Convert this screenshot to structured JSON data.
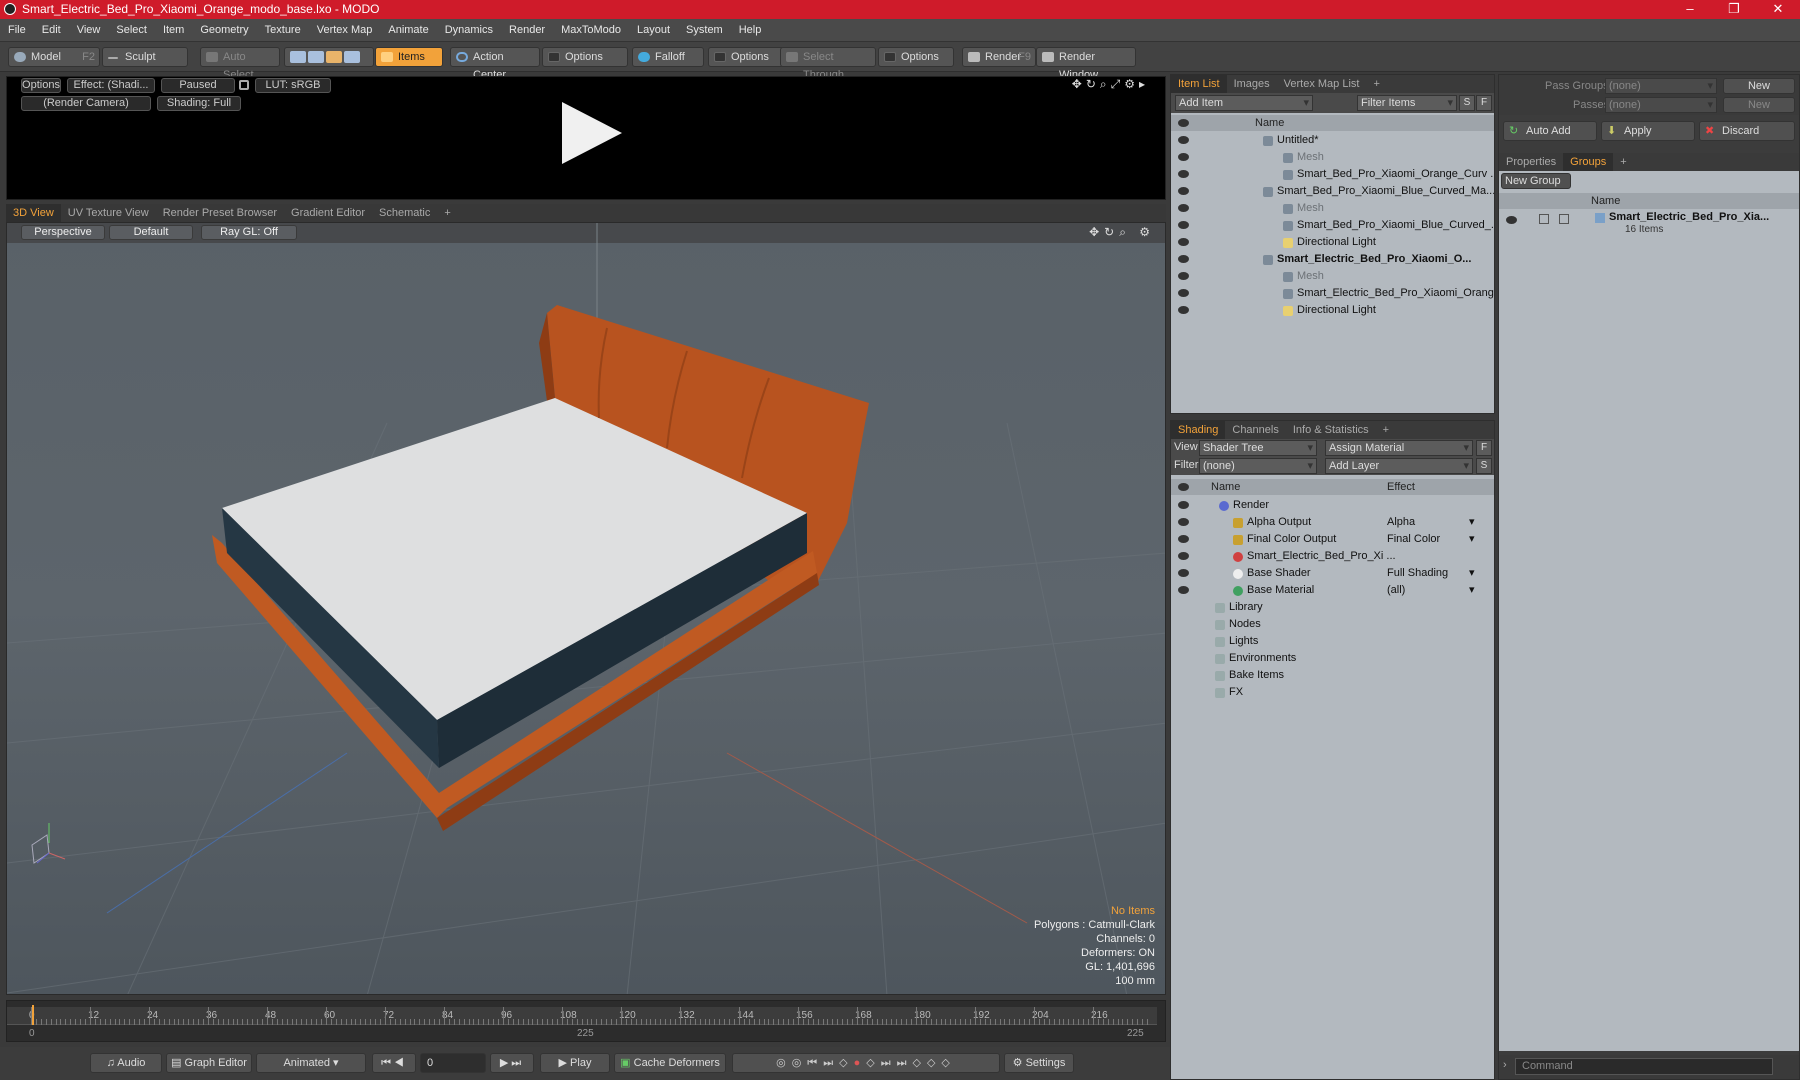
{
  "window": {
    "title": "Smart_Electric_Bed_Pro_Xiaomi_Orange_modo_base.lxo - MODO",
    "controls": [
      "–",
      "❐",
      "✕"
    ]
  },
  "menu": [
    "File",
    "Edit",
    "View",
    "Select",
    "Item",
    "Geometry",
    "Texture",
    "Vertex Map",
    "Animate",
    "Dynamics",
    "Render",
    "MaxToModo",
    "Layout",
    "System",
    "Help"
  ],
  "toolbar": {
    "model": "Model",
    "model_key": "F2",
    "sculpt": "Sculpt",
    "auto_select": "Auto Select",
    "items": "Items",
    "action_center": "Action Center",
    "options1": "Options",
    "falloff": "Falloff",
    "options2": "Options",
    "select_through": "Select Through",
    "options3": "Options",
    "render": "Render",
    "render_key": "F9",
    "render_window": "Render Window"
  },
  "preview": {
    "options": "Options",
    "effect": "Effect: (Shadi...",
    "paused": "Paused",
    "lut": "LUT: sRGB",
    "camera": "(Render Camera)",
    "shading": "Shading: Full"
  },
  "view_tabs": [
    "3D View",
    "UV Texture View",
    "Render Preset Browser",
    "Gradient Editor",
    "Schematic"
  ],
  "viewport": {
    "perspective": "Perspective",
    "default": "Default",
    "raygl": "Ray GL: Off",
    "hud": {
      "no_items": "No Items",
      "polygons": "Polygons : Catmull-Clark",
      "channels": "Channels: 0",
      "deformers": "Deformers: ON",
      "gl": "GL: 1,401,696",
      "scale": "100 mm"
    }
  },
  "timeline": {
    "ticks": [
      "0",
      "12",
      "24",
      "36",
      "48",
      "60",
      "72",
      "84",
      "96",
      "108",
      "120",
      "132",
      "144",
      "156",
      "168",
      "180",
      "192",
      "204",
      "216"
    ],
    "start": "0",
    "mid": "225",
    "end": "225"
  },
  "transport": {
    "audio": "Audio",
    "graph_editor": "Graph Editor",
    "animated": "Animated",
    "frame": "0",
    "play": "Play",
    "cache_deformers": "Cache Deformers",
    "settings": "Settings"
  },
  "item_list": {
    "tabs": [
      "Item List",
      "Images",
      "Vertex Map List"
    ],
    "add_item": "Add Item",
    "filter_items": "Filter Items",
    "s": "S",
    "f": "F",
    "col_name": "Name",
    "rows": [
      {
        "label": "Untitled*",
        "indent": 0,
        "style": "normal"
      },
      {
        "label": "Mesh",
        "indent": 1,
        "style": "dim"
      },
      {
        "label": "Smart_Bed_Pro_Xiaomi_Orange_Curv ...",
        "indent": 1,
        "style": "normal"
      },
      {
        "label": "Smart_Bed_Pro_Xiaomi_Blue_Curved_Ma...",
        "indent": 0,
        "style": "normal"
      },
      {
        "label": "Mesh",
        "indent": 1,
        "style": "dim"
      },
      {
        "label": "Smart_Bed_Pro_Xiaomi_Blue_Curved_...",
        "indent": 1,
        "style": "normal"
      },
      {
        "label": "Directional Light",
        "indent": 1,
        "style": "normal"
      },
      {
        "label": "Smart_Electric_Bed_Pro_Xiaomi_O...",
        "indent": 0,
        "style": "bold"
      },
      {
        "label": "Mesh",
        "indent": 1,
        "style": "dim"
      },
      {
        "label": "Smart_Electric_Bed_Pro_Xiaomi_Orang...",
        "indent": 1,
        "style": "normal"
      },
      {
        "label": "Directional Light",
        "indent": 1,
        "style": "normal"
      }
    ]
  },
  "shading": {
    "tabs": [
      "Shading",
      "Channels",
      "Info & Statistics"
    ],
    "view_label": "View",
    "view_value": "Shader Tree",
    "assign_material": "Assign Material",
    "filter_label": "Filter",
    "filter_value": "(none)",
    "add_layer": "Add Layer",
    "f": "F",
    "s": "S",
    "col_name": "Name",
    "col_effect": "Effect",
    "rows": [
      {
        "label": "Render",
        "effect": "",
        "indent": 0
      },
      {
        "label": "Alpha Output",
        "effect": "Alpha",
        "indent": 1
      },
      {
        "label": "Final Color Output",
        "effect": "Final Color",
        "indent": 1
      },
      {
        "label": "Smart_Electric_Bed_Pro_Xi ...",
        "effect": "",
        "indent": 1
      },
      {
        "label": "Base Shader",
        "effect": "Full Shading",
        "indent": 1
      },
      {
        "label": "Base Material",
        "effect": "(all)",
        "indent": 1
      },
      {
        "label": "Library",
        "effect": "",
        "indent": 0
      },
      {
        "label": "Nodes",
        "effect": "",
        "indent": 0
      },
      {
        "label": "Lights",
        "effect": "",
        "indent": 0
      },
      {
        "label": "Environments",
        "effect": "",
        "indent": 0
      },
      {
        "label": "Bake Items",
        "effect": "",
        "indent": 0
      },
      {
        "label": "FX",
        "effect": "",
        "indent": 0
      }
    ]
  },
  "groups": {
    "pass_groups": "Pass Groups",
    "pass_value": "(none)",
    "passes": "Passes",
    "passes_value": "(none)",
    "new": "New",
    "new2": "New",
    "auto_add": "Auto Add",
    "apply": "Apply",
    "discard": "Discard",
    "tabs": [
      "Properties",
      "Groups"
    ],
    "new_group": "New Group",
    "col_name": "Name",
    "group_name": "Smart_Electric_Bed_Pro_Xia...",
    "group_count": "16 Items",
    "command": "Command"
  }
}
